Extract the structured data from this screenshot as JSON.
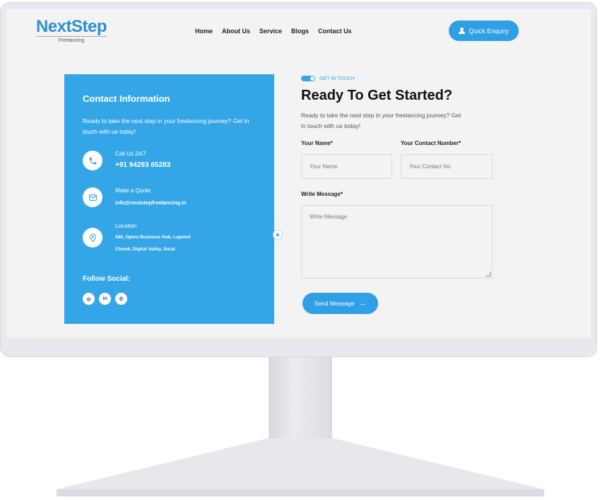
{
  "header": {
    "logo_main": "NextStep",
    "logo_sub": "Freelancing",
    "nav": [
      "Home",
      "About Us",
      "Service",
      "Blogs",
      "Contact Us"
    ],
    "quick_enquiry": "Quick Enquiry"
  },
  "contact": {
    "title": "Contact Information",
    "description": "Ready to take the next step in your freelancing journey? Get in touch with us today!",
    "items": [
      {
        "icon": "phone-icon",
        "label": "Call Us 24/7",
        "value": "+91 94293 65283"
      },
      {
        "icon": "mail-icon",
        "label": "Make a Quote",
        "value": "info@nextstepfreelancing.in"
      },
      {
        "icon": "location-pin-icon",
        "label": "Location",
        "value_line1": "440, Opera Business Hub, Lajamni",
        "value_line2": "Chowk, Digital Valley, Surat"
      }
    ],
    "follow": "Follow Social:",
    "socials": [
      {
        "icon": "instagram-icon",
        "glyph": "◎"
      },
      {
        "icon": "linkedin-icon",
        "glyph": "in"
      },
      {
        "icon": "whatsapp-icon",
        "glyph": "✆"
      }
    ]
  },
  "form": {
    "eyebrow": "GET IN TOUCH",
    "title": "Ready To Get Started?",
    "description": "Ready to take the next step in your freelancing journey? Get in touch with us today!",
    "name_label": "Your Name*",
    "name_placeholder": "Your Name",
    "contact_label": "Your Contact Number*",
    "contact_placeholder": "Your Contact No",
    "message_label": "Write Message*",
    "message_placeholder": "Write Message",
    "send": "Send Message"
  },
  "colors": {
    "accent": "#34a6e8",
    "button": "#2f9fe6",
    "bezel": "#e9e8ee"
  }
}
